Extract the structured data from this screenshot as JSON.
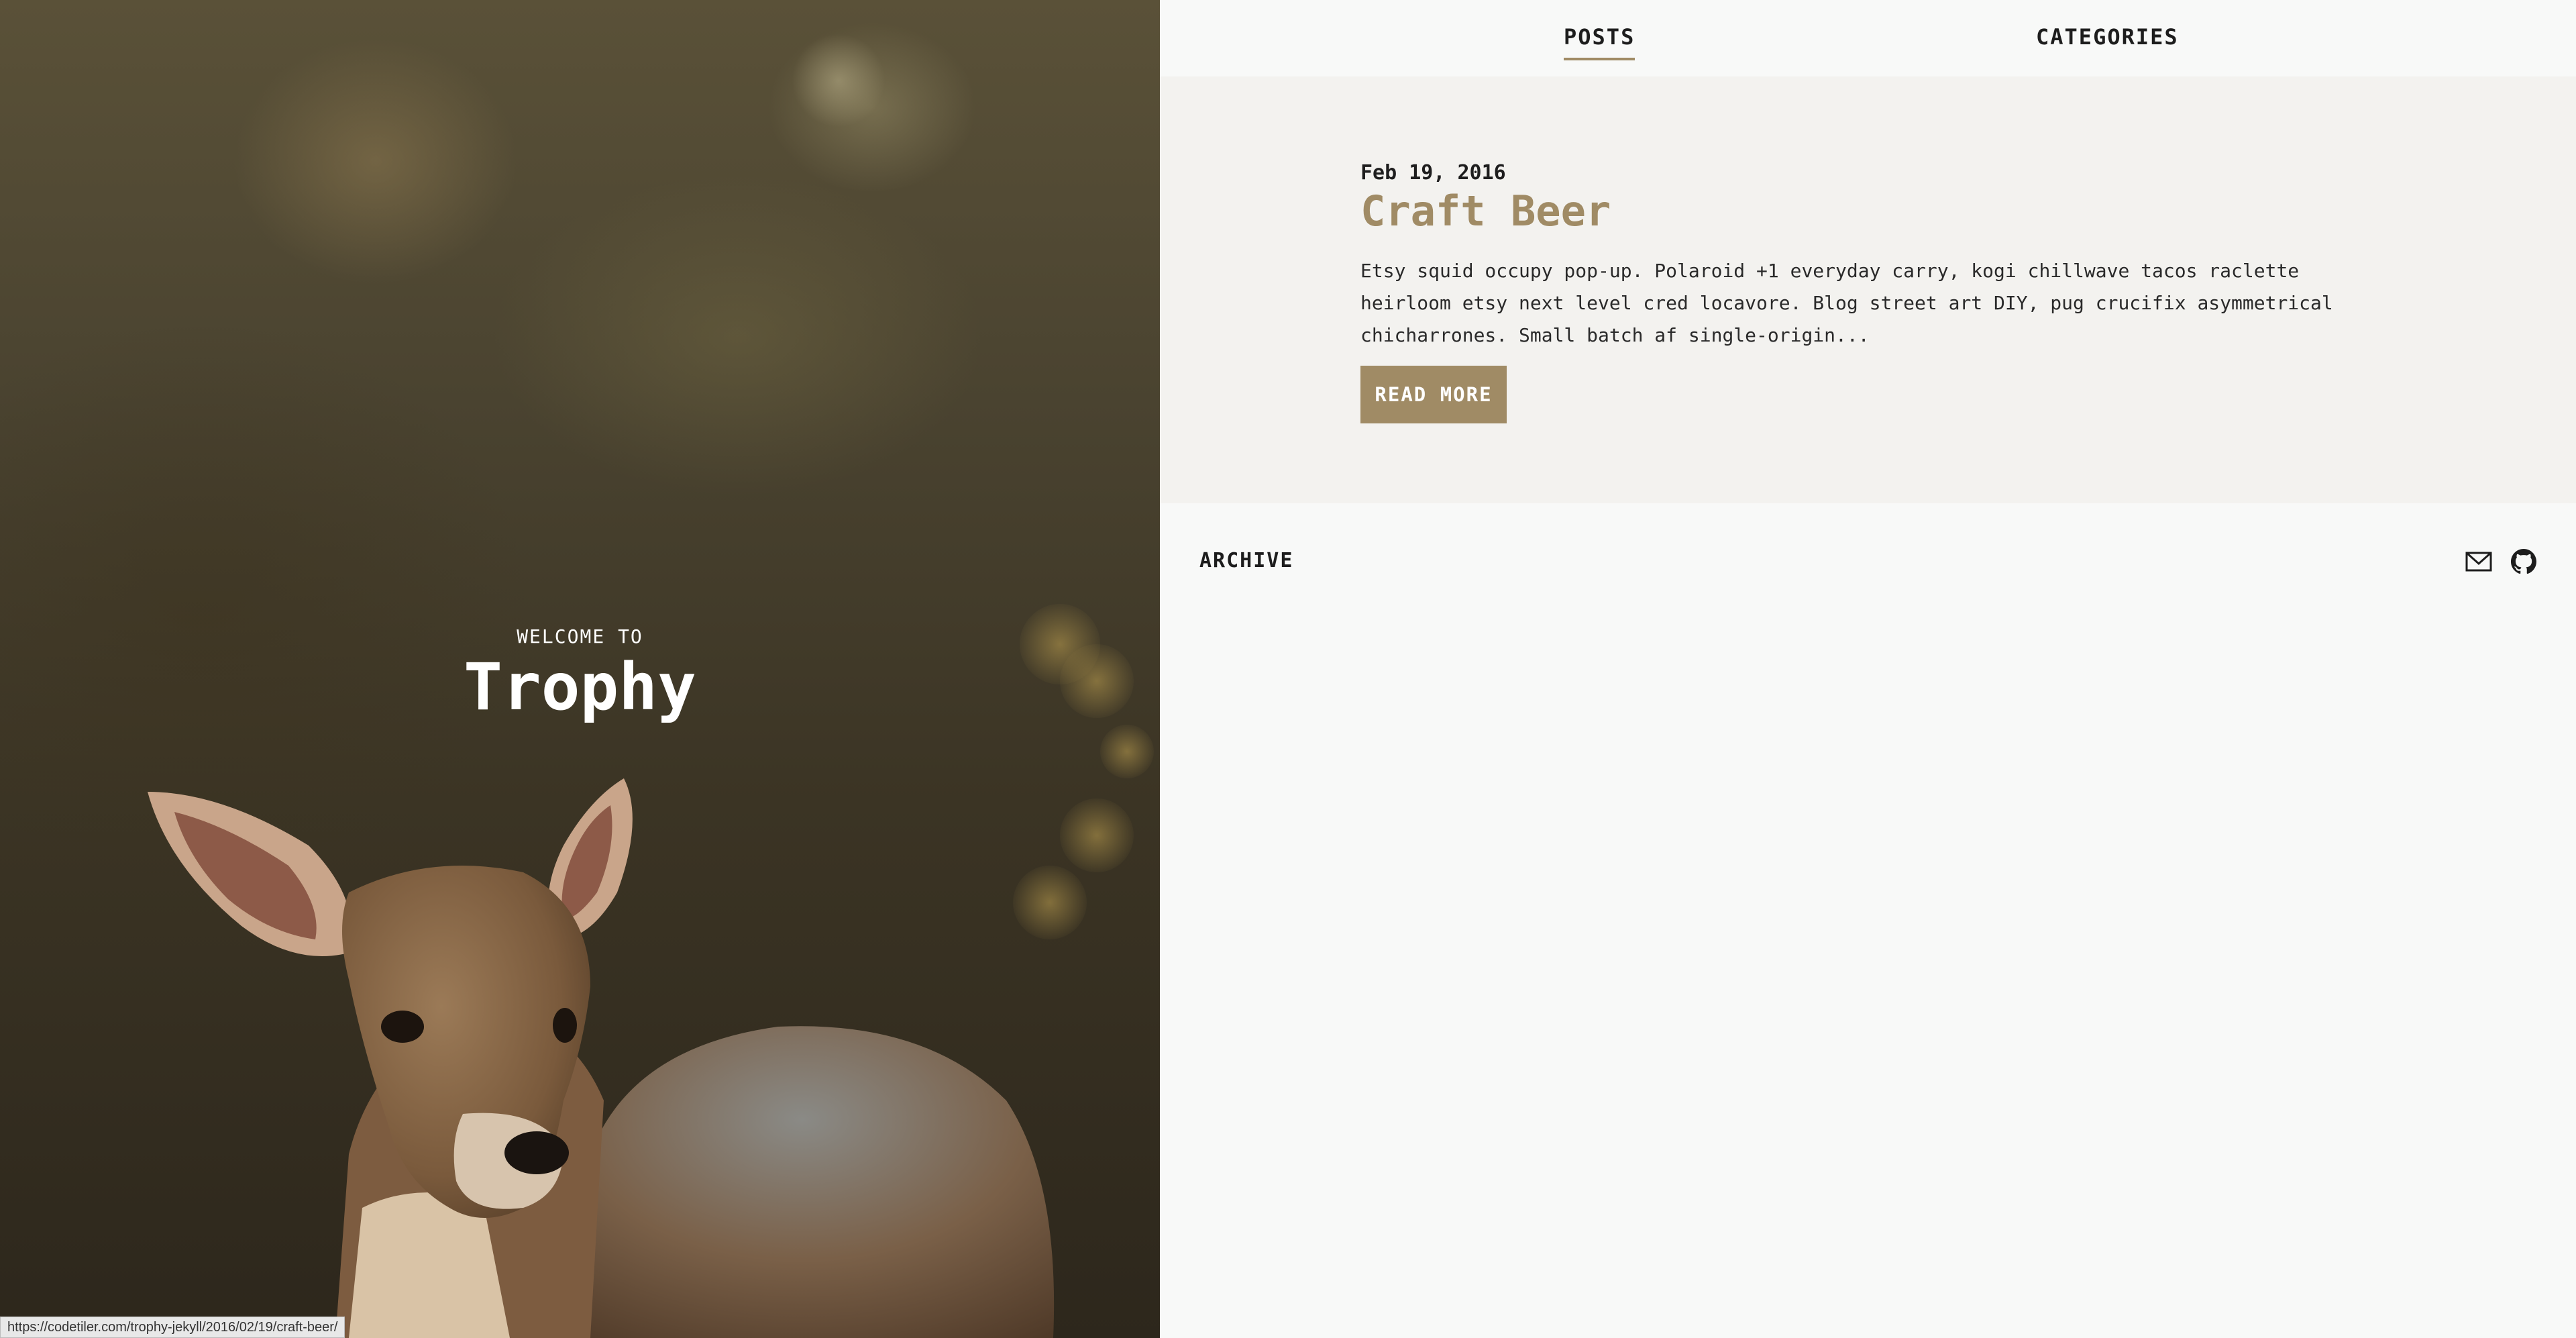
{
  "hero": {
    "welcome": "WELCOME TO",
    "title": "Trophy",
    "status_url": "https://codetiler.com/trophy-jekyll/2016/02/19/craft-beer/"
  },
  "nav": {
    "items": [
      {
        "label": "POSTS"
      },
      {
        "label": "CATEGORIES"
      }
    ]
  },
  "post": {
    "date": "Feb 19, 2016",
    "title": "Craft Beer",
    "excerpt": "Etsy squid occupy pop-up. Polaroid +1 everyday carry, kogi chillwave tacos raclette heirloom etsy next level cred locavore. Blog street art DIY, pug crucifix asymmetrical chicharrones. Small batch af single-origin...",
    "read_more": "READ MORE"
  },
  "footer": {
    "archive": "ARCHIVE",
    "icons": [
      "mail-icon",
      "github-icon"
    ]
  },
  "colors": {
    "accent": "#a08b65",
    "panel_bg": "#f8f9f8",
    "post_bg": "#f3f2ef",
    "text": "#1d1d1d"
  }
}
